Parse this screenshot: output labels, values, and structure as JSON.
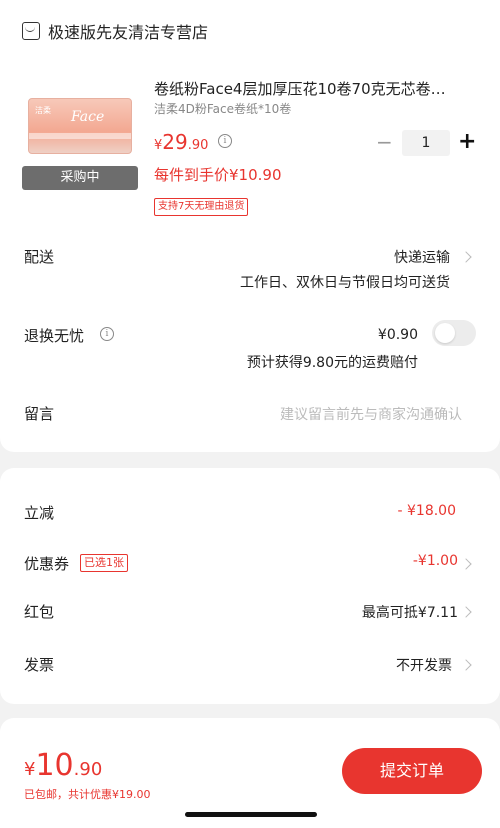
{
  "shop": {
    "name": "极速版先友清洁专营店",
    "icon": "store-icon"
  },
  "product": {
    "title": "卷纸粉Face4层加厚压花10卷70克无芯卷…",
    "spec": "洁柔4D粉Face卷纸*10卷",
    "price_currency": "¥",
    "price_int": "29",
    "price_dec": ".90",
    "status_badge": "采购中",
    "per_price": "每件到手价¥10.90",
    "return_tag": "支持7天无理由退货",
    "quantity": "1",
    "image_logo": "Face",
    "image_brand": "洁柔"
  },
  "delivery": {
    "label": "配送",
    "value": "快递运输",
    "note": "工作日、双休日与节假日均可送货"
  },
  "return_insurance": {
    "label": "退换无忧",
    "price": "¥0.90",
    "note": "预计获得9.80元的运费赔付",
    "enabled": false
  },
  "message": {
    "label": "留言",
    "placeholder": "建议留言前先与商家沟通确认"
  },
  "discounts": {
    "instant": {
      "label": "立减",
      "value": "- ¥18.00"
    },
    "coupon": {
      "label": "优惠券",
      "tag": "已选1张",
      "value": "-¥1.00"
    },
    "red_packet": {
      "label": "红包",
      "value": "最高可抵¥7.11"
    },
    "invoice": {
      "label": "发票",
      "value": "不开发票"
    }
  },
  "footer": {
    "total_currency": "¥",
    "total_int": "10",
    "total_dec": ".90",
    "summary": "已包邮，共计优惠¥19.00",
    "submit_label": "提交订单"
  },
  "colors": {
    "accent": "#e8352f"
  }
}
